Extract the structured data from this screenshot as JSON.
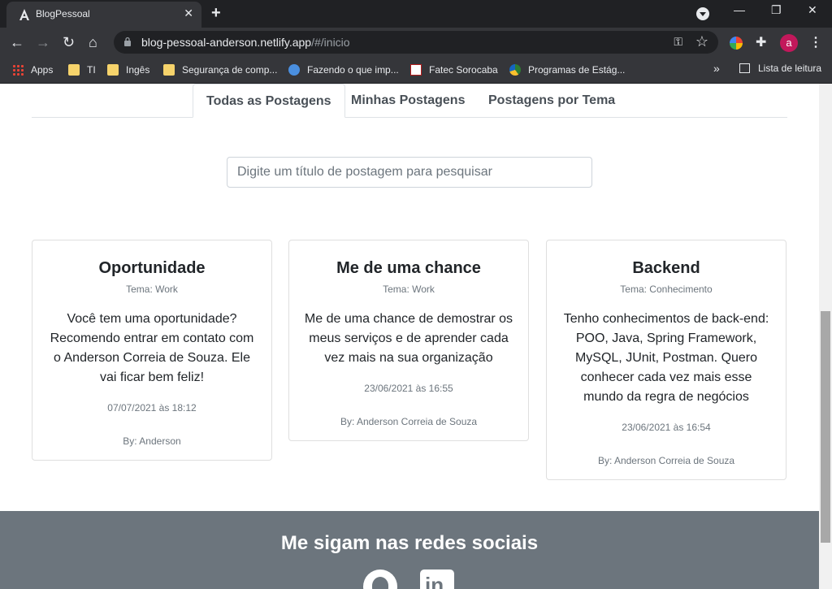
{
  "browser": {
    "tab_title": "BlogPessoal",
    "url_host": "blog-pessoal-anderson.netlify.app",
    "url_path": "/#/inicio",
    "profile_initial": "a",
    "bookmarks": [
      {
        "label": "Apps",
        "icon": "apps-grid-icon"
      },
      {
        "label": "TI",
        "icon": "folder-icon"
      },
      {
        "label": "Ingês",
        "icon": "folder-icon"
      },
      {
        "label": "Segurança de comp...",
        "icon": "folder-icon"
      },
      {
        "label": "Fazendo o que imp...",
        "icon": "globe-icon"
      },
      {
        "label": "Fatec Sorocaba",
        "icon": "fatec-icon"
      },
      {
        "label": "Programas de Estág...",
        "icon": "gov-icon"
      }
    ],
    "reading_list": "Lista de leitura"
  },
  "page": {
    "tabs": [
      {
        "label": "Todas as Postagens",
        "active": true
      },
      {
        "label": "Minhas Postagens",
        "active": false
      },
      {
        "label": "Postagens por Tema",
        "active": false
      }
    ],
    "search_placeholder": "Digite um título de postagem para pesquisar",
    "posts": [
      {
        "title": "Oportunidade",
        "theme": "Tema: Work",
        "text": "Você tem uma oportunidade? Recomendo entrar em contato com o Anderson Correia de Souza. Ele vai ficar bem feliz!",
        "date": "07/07/2021 às 18:12",
        "author": "By: Anderson"
      },
      {
        "title": "Me de uma chance",
        "theme": "Tema: Work",
        "text": "Me de uma chance de demostrar os meus serviços e de aprender cada vez mais na sua organização",
        "date": "23/06/2021 às 16:55",
        "author": "By: Anderson Correia de Souza"
      },
      {
        "title": "Backend",
        "theme": "Tema: Conhecimento",
        "text": "Tenho conhecimentos de back-end: POO, Java, Spring Framework, MySQL, JUnit, Postman. Quero conhecer cada vez mais esse mundo da regra de negócios",
        "date": "23/06/2021 às 16:54",
        "author": "By: Anderson Correia de Souza"
      }
    ],
    "footer_title": "Me sigam nas redes sociais",
    "social": [
      "github-icon",
      "linkedin-icon"
    ]
  },
  "colors": {
    "footer_bg": "#6c757d",
    "chrome_dark": "#202124",
    "chrome_toolbar": "#35363a"
  }
}
